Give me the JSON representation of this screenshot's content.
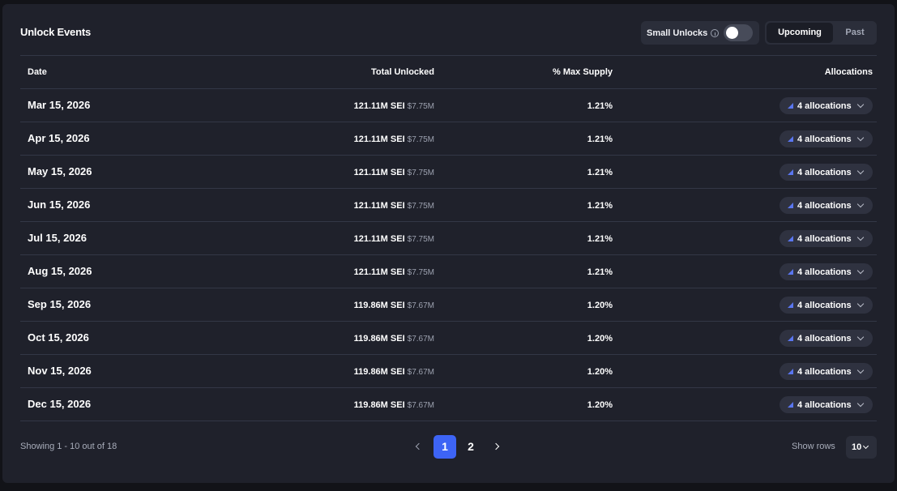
{
  "title": "Unlock Events",
  "small_unlocks": {
    "label": "Small Unlocks",
    "enabled": false
  },
  "tabs": {
    "upcoming": "Upcoming",
    "past": "Past",
    "active": "Upcoming"
  },
  "columns": {
    "date": "Date",
    "total": "Total Unlocked",
    "pct": "% Max Supply",
    "alloc": "Allocations"
  },
  "rows": [
    {
      "date": "Mar 15, 2026",
      "amount": "121.11M SEI",
      "usd": "$7.75M",
      "pct": "1.21%",
      "alloc": "4 allocations"
    },
    {
      "date": "Apr 15, 2026",
      "amount": "121.11M SEI",
      "usd": "$7.75M",
      "pct": "1.21%",
      "alloc": "4 allocations"
    },
    {
      "date": "May 15, 2026",
      "amount": "121.11M SEI",
      "usd": "$7.75M",
      "pct": "1.21%",
      "alloc": "4 allocations"
    },
    {
      "date": "Jun 15, 2026",
      "amount": "121.11M SEI",
      "usd": "$7.75M",
      "pct": "1.21%",
      "alloc": "4 allocations"
    },
    {
      "date": "Jul 15, 2026",
      "amount": "121.11M SEI",
      "usd": "$7.75M",
      "pct": "1.21%",
      "alloc": "4 allocations"
    },
    {
      "date": "Aug 15, 2026",
      "amount": "121.11M SEI",
      "usd": "$7.75M",
      "pct": "1.21%",
      "alloc": "4 allocations"
    },
    {
      "date": "Sep 15, 2026",
      "amount": "119.86M SEI",
      "usd": "$7.67M",
      "pct": "1.20%",
      "alloc": "4 allocations"
    },
    {
      "date": "Oct 15, 2026",
      "amount": "119.86M SEI",
      "usd": "$7.67M",
      "pct": "1.20%",
      "alloc": "4 allocations"
    },
    {
      "date": "Nov 15, 2026",
      "amount": "119.86M SEI",
      "usd": "$7.67M",
      "pct": "1.20%",
      "alloc": "4 allocations"
    },
    {
      "date": "Dec 15, 2026",
      "amount": "119.86M SEI",
      "usd": "$7.67M",
      "pct": "1.20%",
      "alloc": "4 allocations"
    }
  ],
  "footer": {
    "showing": "Showing 1 - 10 out of 18",
    "pages": [
      "1",
      "2"
    ],
    "current_page": "1",
    "show_rows_label": "Show rows",
    "rows_value": "10"
  },
  "colors": {
    "accent": "#3d64f5",
    "card_bg": "#1f212b",
    "page_bg": "#121318"
  },
  "icons": [
    "info-icon",
    "chevron-down-icon",
    "allocation-triangle-icon",
    "chevron-left-icon",
    "chevron-right-icon"
  ]
}
